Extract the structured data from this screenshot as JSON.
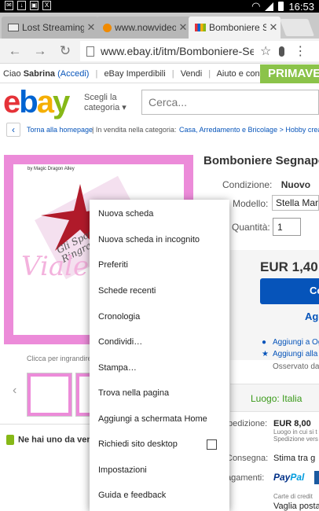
{
  "status_bar": {
    "time": "16:53"
  },
  "tabs": [
    {
      "title": "Lost Streaming"
    },
    {
      "title": "www.nowvideo.li"
    },
    {
      "title": "Bomboniere Segna"
    }
  ],
  "omnibox": {
    "url": "www.ebay.it/itm/Bomboniere-Segn"
  },
  "ebay_top": {
    "greeting": "Ciao",
    "user": "Sabrina",
    "accedi": "(Accedi)",
    "links": [
      "eBay Imperdibili",
      "Vendi",
      "Aiuto e contatti"
    ],
    "promo": "PRIMAVE"
  },
  "header": {
    "logo": [
      "e",
      "b",
      "a",
      "y"
    ],
    "category_line1": "Scegli la",
    "category_line2": "categoria ▾",
    "search_placeholder": "Cerca..."
  },
  "breadcrumb": {
    "back_label": "Torna alla homepage",
    "prefix": "| In vendita nella categoria:",
    "path": "Casa, Arredamento e Bricolage  >  Hobby creativi"
  },
  "product": {
    "title": "Bomboniere Segnapos",
    "image_brand": "by Magic Dragon Alley",
    "image_text_1": "Gli Sposi",
    "image_text_2": "Ringraziano",
    "image_script": "Viale",
    "caption": "Clicca per ingrandire l'",
    "condition_label": "Condizione:",
    "condition_value": "Nuovo",
    "model_label": "Modello:",
    "model_value": "Stella Marin",
    "quantity_label": "Quantità:",
    "quantity_value": "1",
    "price": "EUR 1,40",
    "buy_label": "Co",
    "add_label": "Agg",
    "watch_1": "Aggiungi a Og",
    "watch_2": "Aggiungi alla",
    "observed": "Osservato da",
    "luogo": "Luogo: Italia",
    "shipping_label": "pedizione:",
    "shipping_value": "EUR 8,00",
    "shipping_note_1": "Luogo in cui si t",
    "shipping_note_2": "Spedizione vers",
    "consegna_label": "Consegna:",
    "consegna_value": "Stima tra g",
    "pagamenti_label": "agamenti:",
    "paypal_1": "Pay",
    "paypal_2": "Pal",
    "carte": "Carte di credit",
    "vaglia": "Vaglia posta",
    "nehai": "Ne hai uno da vend"
  },
  "menu": {
    "items": [
      "Nuova scheda",
      "Nuova scheda in incognito",
      "Preferiti",
      "Schede recenti",
      "Cronologia",
      "Condividi…",
      "Stampa…",
      "Trova nella pagina",
      "Aggiungi a schermata Home",
      "Richiedi sito desktop",
      "Impostazioni",
      "Guida e feedback"
    ]
  }
}
